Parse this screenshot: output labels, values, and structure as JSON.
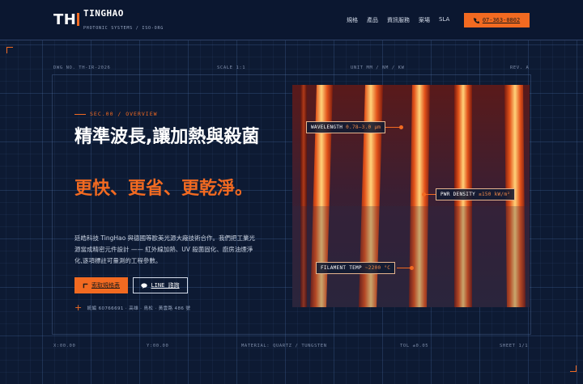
{
  "header": {
    "logo_text": "TH",
    "brand_name": "TINGHAO",
    "brand_sub": "PHOTONIC SYSTEMS / ISO-ORG",
    "nav": [
      "規格",
      "產品",
      "資訊服務",
      "案場",
      "SLA"
    ],
    "phone": "07-363-0802"
  },
  "meta": {
    "drawing_no": "DWG NO. TH-IR-2026",
    "scale": "SCALE 1:1",
    "unit": "UNIT MM / NM / KW",
    "rev": "REV. A",
    "x": "X:00.00",
    "y": "Y:00.00",
    "material": "MATERIAL: QUARTZ / TUNGSTEN",
    "tol": "TOL ±0.05",
    "sheet": "SHEET 1/1"
  },
  "hero": {
    "section": "SEC.00 / OVERVIEW",
    "title": "精準波長,讓加熱與殺菌",
    "title_accent": "更快、更省、更乾淨。",
    "description": "廷皓科技 TingHao 與德國等歐美光源大廠技術合作。我們把工業光源當成精密元件設計 —— 紅外線加熱、UV 殺菌固化、廚房油煙淨化,逐項標註可量測的工程參數。",
    "btn_spec": "索取規格表",
    "btn_line": "LINE 諮詢",
    "tax_id": "統編 60766691 · 高雄 · 鳥松 · 黃雲路 486 號"
  },
  "callouts": {
    "wavelength_label": "WAVELENGTH",
    "wavelength_value": "0.78–3.0 μm",
    "power_label": "PWR DENSITY",
    "power_value": "≤150 kW/m²",
    "filament_label": "FILAMENT TEMP",
    "filament_value": "~2200 °C"
  },
  "colors": {
    "accent": "#f26a21",
    "background": "#0d1a33"
  }
}
